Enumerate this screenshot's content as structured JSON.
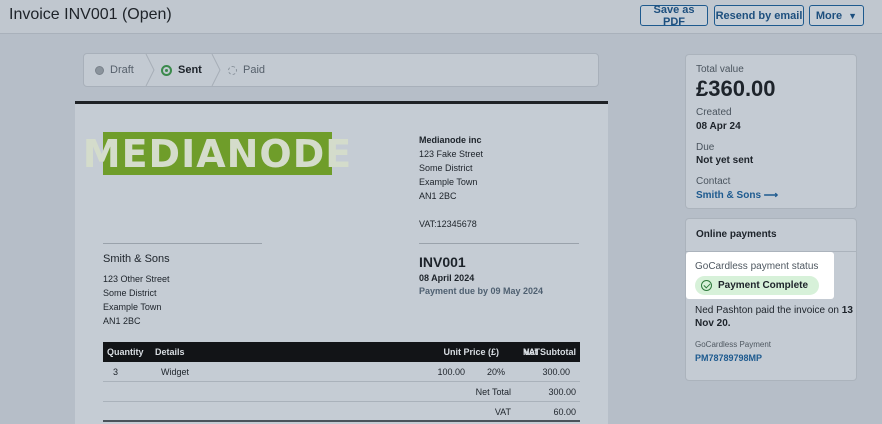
{
  "header": {
    "title": "Invoice INV001 (Open)",
    "buttons": {
      "save_pdf": "Save as PDF",
      "resend": "Resend by email",
      "more": "More"
    }
  },
  "stepper": {
    "draft": "Draft",
    "sent": "Sent",
    "paid": "Paid"
  },
  "invoice": {
    "logo_text": "MEDIANODE",
    "from": {
      "name": "Medianode inc",
      "lines": [
        "123 Fake Street",
        "Some District",
        "Example Town",
        "AN1 2BC"
      ],
      "vat": "VAT:12345678"
    },
    "to": {
      "name": "Smith & Sons",
      "lines": [
        "123 Other Street",
        "Some District",
        "Example Town",
        "AN1 2BC"
      ]
    },
    "number": "INV001",
    "date": "08 April 2024",
    "due": "Payment due by 09 May 2024",
    "table": {
      "headers": {
        "quantity": "Quantity",
        "details": "Details",
        "unit_price": "Unit Price (£)",
        "vat": "VAT",
        "net_subtotal": "Net Subtotal"
      },
      "rows": [
        {
          "quantity": "3",
          "details": "Widget",
          "unit_price": "100.00",
          "vat": "20%",
          "net_subtotal": "300.00"
        }
      ],
      "totals": [
        {
          "label": "Net Total",
          "value": "300.00"
        },
        {
          "label": "VAT",
          "value": "60.00"
        }
      ]
    }
  },
  "summary": {
    "total_label": "Total value",
    "total_value": "£360.00",
    "created_label": "Created",
    "created_value": "08 Apr 24",
    "due_label": "Due",
    "due_value": "Not yet sent",
    "contact_label": "Contact",
    "contact_value": "Smith & Sons ⟶"
  },
  "online_payments": {
    "title": "Online payments",
    "status_label": "GoCardless payment status",
    "status_value": "Payment Complete",
    "paid_text": "Ned Pashton paid the invoice on",
    "paid_date": "13 Nov 20.",
    "payment_label": "GoCardless Payment",
    "payment_id": "PM78789798MP"
  }
}
